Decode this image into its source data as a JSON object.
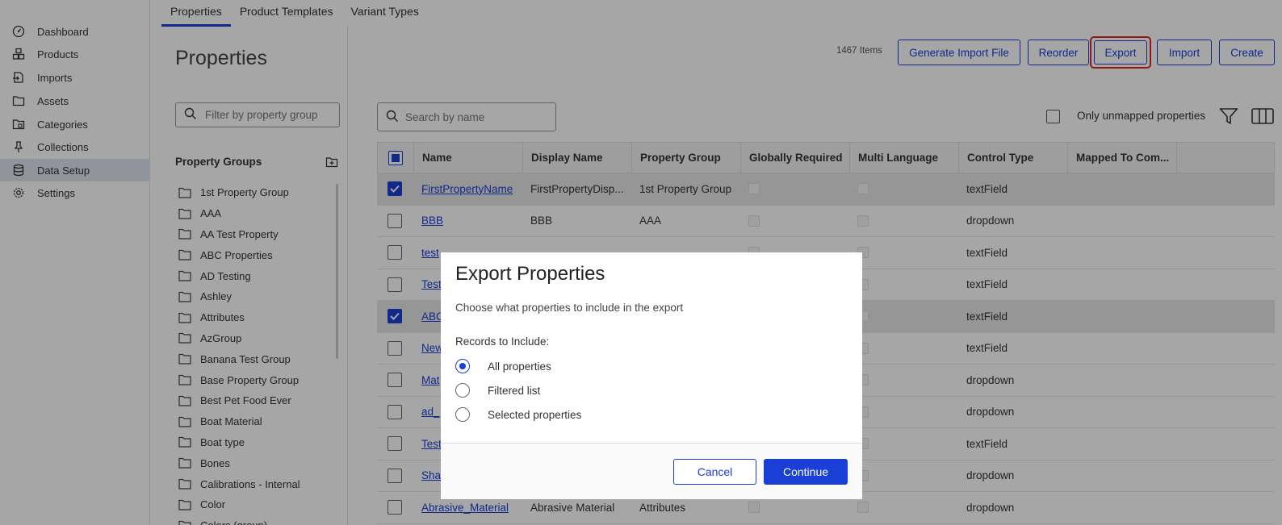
{
  "sidebar": {
    "items": [
      {
        "label": "Dashboard",
        "icon": "dashboard-icon"
      },
      {
        "label": "Products",
        "icon": "products-icon"
      },
      {
        "label": "Imports",
        "icon": "imports-icon"
      },
      {
        "label": "Assets",
        "icon": "folder-icon"
      },
      {
        "label": "Categories",
        "icon": "categories-icon"
      },
      {
        "label": "Collections",
        "icon": "pin-icon"
      },
      {
        "label": "Data Setup",
        "icon": "database-icon"
      },
      {
        "label": "Settings",
        "icon": "gear-icon"
      }
    ],
    "active": "Data Setup"
  },
  "tabs": [
    {
      "label": "Properties"
    },
    {
      "label": "Product Templates"
    },
    {
      "label": "Variant Types"
    }
  ],
  "page_title": "Properties",
  "filter": {
    "placeholder": "Filter by property group"
  },
  "property_groups": {
    "heading": "Property Groups",
    "items": [
      "1st Property Group",
      "AAA",
      "AA Test Property",
      "ABC Properties",
      "AD Testing",
      "Ashley",
      "Attributes",
      "AzGroup",
      "Banana Test Group",
      "Base Property Group",
      "Best Pet Food Ever",
      "Boat Material",
      "Boat type",
      "Bones",
      "Calibrations - Internal",
      "Color",
      "Colors (group)"
    ]
  },
  "toolbar": {
    "count": "1467 Items",
    "generate_label": "Generate Import File",
    "reorder_label": "Reorder",
    "export_label": "Export",
    "import_label": "Import",
    "create_label": "Create"
  },
  "search": {
    "placeholder": "Search by name"
  },
  "unmapped_label": "Only unmapped properties",
  "table": {
    "columns": [
      "Name",
      "Display Name",
      "Property Group",
      "Globally Required",
      "Multi Language",
      "Control Type",
      "Mapped To Com..."
    ],
    "rows": [
      {
        "name": "FirstPropertyName",
        "display": "FirstPropertyDisp...",
        "group": "1st Property Group",
        "control": "textField",
        "selected": true
      },
      {
        "name": "BBB",
        "display": "BBB",
        "group": "AAA",
        "control": "dropdown",
        "selected": false
      },
      {
        "name": "test",
        "display": "",
        "group": "",
        "control": "textField",
        "selected": false
      },
      {
        "name": "Test",
        "display": "",
        "group": "",
        "control": "textField",
        "selected": false
      },
      {
        "name": "ABC",
        "display": "",
        "group": "",
        "control": "textField",
        "selected": true
      },
      {
        "name": "New",
        "display": "",
        "group": "",
        "control": "textField",
        "selected": false
      },
      {
        "name": "Mat",
        "display": "",
        "group": "",
        "control": "dropdown",
        "selected": false
      },
      {
        "name": "ad_",
        "display": "",
        "group": "",
        "control": "dropdown",
        "selected": false
      },
      {
        "name": "Test",
        "display": "",
        "group": "",
        "control": "textField",
        "selected": false
      },
      {
        "name": "Sha",
        "display": "",
        "group": "",
        "control": "dropdown",
        "selected": false
      },
      {
        "name": "Abrasive_Material",
        "display": "Abrasive Material",
        "group": "Attributes",
        "control": "dropdown",
        "selected": false
      }
    ]
  },
  "modal": {
    "title": "Export Properties",
    "subtitle": "Choose what properties to include in the export",
    "records_label": "Records to Include:",
    "options": [
      "All properties",
      "Filtered list",
      "Selected properties"
    ],
    "selected_option": "All properties",
    "cancel_label": "Cancel",
    "continue_label": "Continue"
  },
  "colors": {
    "accent": "#1a3fd6",
    "highlight": "#e02424"
  }
}
